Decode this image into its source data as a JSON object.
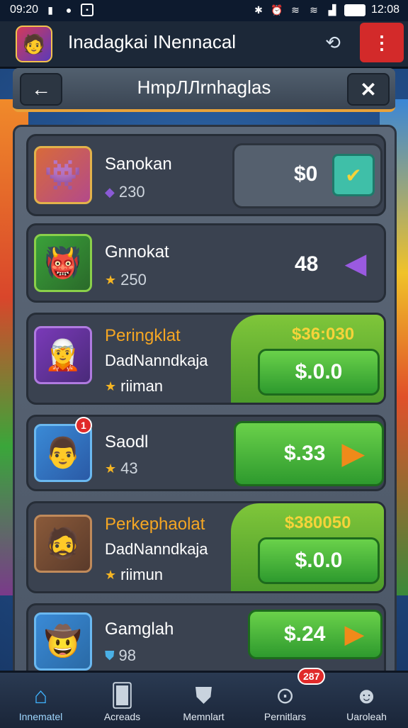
{
  "status_bar": {
    "left_time": "09:20",
    "right_time": "12:08",
    "left_icons": [
      "bookmark-icon",
      "record-icon",
      "photo-icon"
    ],
    "right_icons": [
      "bluetooth-icon",
      "alarm-icon",
      "wifi-icon",
      "wifi-icon",
      "signal-icon",
      "battery-icon"
    ]
  },
  "app": {
    "title": "Inadagkai INennacal",
    "avatar_icon": "character-avatar-icon",
    "share_icon": "share-icon",
    "menu_icon": "more-vertical-icon",
    "menu_color": "#d32a2a"
  },
  "subheader": {
    "title": "HmpЛЛrnhaglas",
    "back_icon": "arrow-left-icon",
    "close_icon": "close-icon",
    "accent_color": "#e8a23a"
  },
  "items": [
    {
      "name": "Sanokan",
      "meta_icon": "gem-icon",
      "meta_value": "230",
      "price": "$0",
      "action_icon": "chevron-down-icon"
    },
    {
      "name": "Gnnokat",
      "meta_icon": "star-icon",
      "meta_value": "250",
      "price": "48",
      "action_icon": "gem-icon"
    },
    {
      "name": "Peringklat",
      "subtitle": "DadNanndkaja",
      "meta_icon": "star-icon",
      "meta_value": "riiman",
      "deal_price": "$36:030",
      "button_label": "$.0.0",
      "highlight": true
    },
    {
      "name": "Saodl",
      "meta_icon": "star-icon",
      "meta_value": "43",
      "price": "$.33",
      "action_icon": "play-arrow-icon",
      "badge": "1"
    },
    {
      "name": "Perkephaolat",
      "subtitle": "DadNanndkaja",
      "meta_icon": "star-icon",
      "meta_value": "riimun",
      "deal_price": "$380050",
      "button_label": "$.0.0",
      "highlight": true
    },
    {
      "name": "Gamglah",
      "meta_icon": "shield-icon",
      "meta_value": "98",
      "price": "$.24",
      "action_icon": "play-arrow-icon"
    }
  ],
  "bottom_nav": [
    {
      "label": "Innematel",
      "icon": "home-icon",
      "active": true
    },
    {
      "label": "Acreads",
      "icon": "cards-icon",
      "active": false
    },
    {
      "label": "Memnlart",
      "icon": "shield-icon",
      "active": false
    },
    {
      "label": "Pernitlars",
      "icon": "location-pin-icon",
      "active": false,
      "badge": "287"
    },
    {
      "label": "Uaroleah",
      "icon": "profile-icon",
      "active": false
    }
  ],
  "colors": {
    "green_button": "#4cb53a",
    "deal_price": "#f5d33a",
    "gold_name": "#f5a623",
    "nav_active": "#3fb3ff"
  }
}
